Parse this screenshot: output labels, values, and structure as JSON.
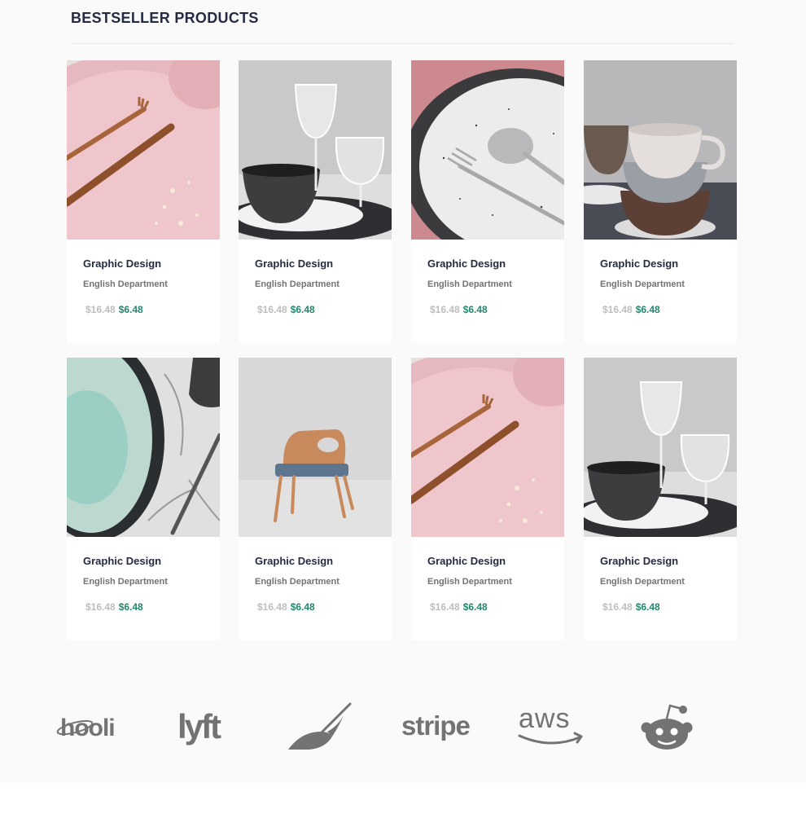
{
  "section": {
    "title": "BESTSELLER PRODUCTS"
  },
  "products": [
    {
      "name": "Graphic Design",
      "department": "English Department",
      "old_price": "$16.48",
      "price": "$6.48",
      "image": "pink-plate-copper-cutlery"
    },
    {
      "name": "Graphic Design",
      "department": "English Department",
      "old_price": "$16.48",
      "price": "$6.48",
      "image": "bowl-and-wine-glasses"
    },
    {
      "name": "Graphic Design",
      "department": "English Department",
      "old_price": "$16.48",
      "price": "$6.48",
      "image": "speckled-plate-spoon-fork"
    },
    {
      "name": "Graphic Design",
      "department": "English Department",
      "old_price": "$16.48",
      "price": "$6.48",
      "image": "stacked-ceramic-cups"
    },
    {
      "name": "Graphic Design",
      "department": "English Department",
      "old_price": "$16.48",
      "price": "$6.48",
      "image": "green-plate-on-marble"
    },
    {
      "name": "Graphic Design",
      "department": "English Department",
      "old_price": "$16.48",
      "price": "$6.48",
      "image": "wooden-chair"
    },
    {
      "name": "Graphic Design",
      "department": "English Department",
      "old_price": "$16.48",
      "price": "$6.48",
      "image": "pink-plate-copper-cutlery"
    },
    {
      "name": "Graphic Design",
      "department": "English Department",
      "old_price": "$16.48",
      "price": "$6.48",
      "image": "bowl-and-wine-glasses"
    }
  ],
  "brands": {
    "hooli": "hooli",
    "lyft": "lyft",
    "leaf": "leaf-logo",
    "stripe": "stripe",
    "aws": "aws",
    "reddit": "reddit-logo"
  },
  "colors": {
    "price_old": "#bdbdbd",
    "price_new": "#23856d",
    "heading": "#252b42",
    "muted": "#737373"
  }
}
